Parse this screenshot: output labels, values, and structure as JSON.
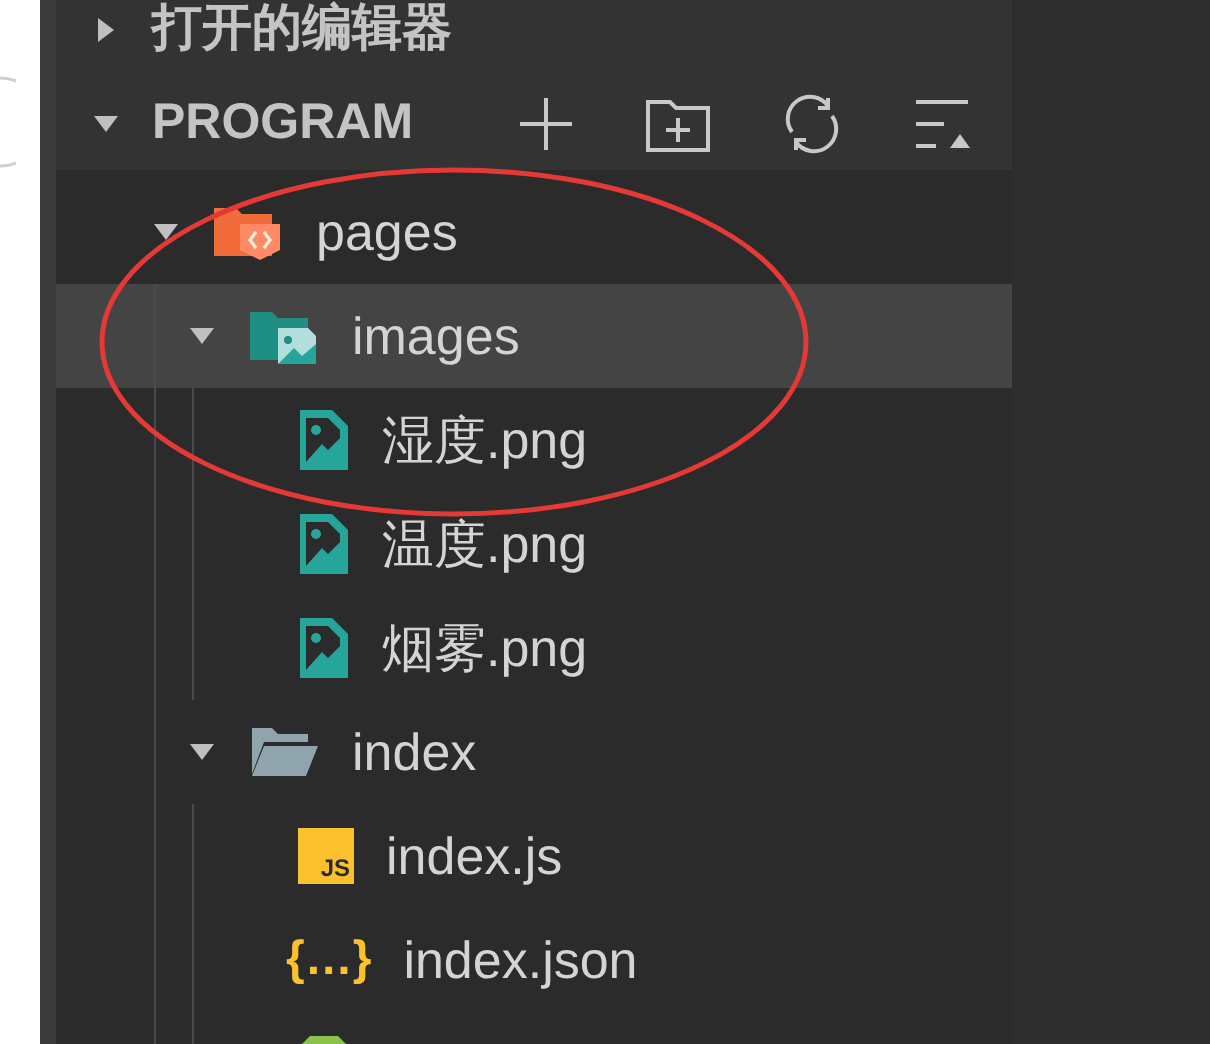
{
  "sections": [
    {
      "title": "打开的编辑器",
      "expanded": false
    },
    {
      "title": "PROGRAM",
      "expanded": true,
      "tools": [
        {
          "kind": "plus"
        },
        {
          "kind": "folder-plus"
        },
        {
          "kind": "refresh"
        },
        {
          "kind": "collapse"
        }
      ]
    }
  ],
  "tree": [
    {
      "name": "pages",
      "kind": "pages-folder",
      "expanded": true,
      "selected": false,
      "children": [
        {
          "name": "images",
          "kind": "images-folder",
          "expanded": true,
          "selected": true,
          "children": [
            {
              "name": "湿度.png",
              "kind": "image",
              "selected": false
            },
            {
              "name": "温度.png",
              "kind": "image",
              "selected": false
            },
            {
              "name": "烟雾.png",
              "kind": "image",
              "selected": false
            }
          ]
        },
        {
          "name": "index",
          "kind": "folder",
          "expanded": true,
          "selected": false,
          "children": [
            {
              "name": "index.js",
              "kind": "js",
              "icon_text": "JS",
              "selected": false
            },
            {
              "name": "index.json",
              "kind": "json",
              "icon_text": "{…}",
              "selected": false
            },
            {
              "kind": "style",
              "selected": false
            }
          ]
        }
      ]
    }
  ],
  "annotation": {
    "kind": "ellipse",
    "color": "#e53935"
  }
}
